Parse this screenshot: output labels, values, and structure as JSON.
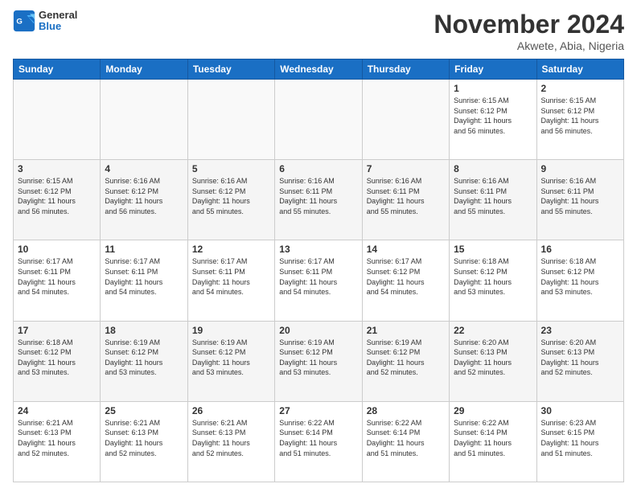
{
  "header": {
    "logo_general": "General",
    "logo_blue": "Blue",
    "month_title": "November 2024",
    "location": "Akwete, Abia, Nigeria"
  },
  "days_of_week": [
    "Sunday",
    "Monday",
    "Tuesday",
    "Wednesday",
    "Thursday",
    "Friday",
    "Saturday"
  ],
  "weeks": [
    [
      {
        "day": "",
        "info": ""
      },
      {
        "day": "",
        "info": ""
      },
      {
        "day": "",
        "info": ""
      },
      {
        "day": "",
        "info": ""
      },
      {
        "day": "",
        "info": ""
      },
      {
        "day": "1",
        "info": "Sunrise: 6:15 AM\nSunset: 6:12 PM\nDaylight: 11 hours\nand 56 minutes."
      },
      {
        "day": "2",
        "info": "Sunrise: 6:15 AM\nSunset: 6:12 PM\nDaylight: 11 hours\nand 56 minutes."
      }
    ],
    [
      {
        "day": "3",
        "info": "Sunrise: 6:15 AM\nSunset: 6:12 PM\nDaylight: 11 hours\nand 56 minutes."
      },
      {
        "day": "4",
        "info": "Sunrise: 6:16 AM\nSunset: 6:12 PM\nDaylight: 11 hours\nand 56 minutes."
      },
      {
        "day": "5",
        "info": "Sunrise: 6:16 AM\nSunset: 6:12 PM\nDaylight: 11 hours\nand 55 minutes."
      },
      {
        "day": "6",
        "info": "Sunrise: 6:16 AM\nSunset: 6:11 PM\nDaylight: 11 hours\nand 55 minutes."
      },
      {
        "day": "7",
        "info": "Sunrise: 6:16 AM\nSunset: 6:11 PM\nDaylight: 11 hours\nand 55 minutes."
      },
      {
        "day": "8",
        "info": "Sunrise: 6:16 AM\nSunset: 6:11 PM\nDaylight: 11 hours\nand 55 minutes."
      },
      {
        "day": "9",
        "info": "Sunrise: 6:16 AM\nSunset: 6:11 PM\nDaylight: 11 hours\nand 55 minutes."
      }
    ],
    [
      {
        "day": "10",
        "info": "Sunrise: 6:17 AM\nSunset: 6:11 PM\nDaylight: 11 hours\nand 54 minutes."
      },
      {
        "day": "11",
        "info": "Sunrise: 6:17 AM\nSunset: 6:11 PM\nDaylight: 11 hours\nand 54 minutes."
      },
      {
        "day": "12",
        "info": "Sunrise: 6:17 AM\nSunset: 6:11 PM\nDaylight: 11 hours\nand 54 minutes."
      },
      {
        "day": "13",
        "info": "Sunrise: 6:17 AM\nSunset: 6:11 PM\nDaylight: 11 hours\nand 54 minutes."
      },
      {
        "day": "14",
        "info": "Sunrise: 6:17 AM\nSunset: 6:12 PM\nDaylight: 11 hours\nand 54 minutes."
      },
      {
        "day": "15",
        "info": "Sunrise: 6:18 AM\nSunset: 6:12 PM\nDaylight: 11 hours\nand 53 minutes."
      },
      {
        "day": "16",
        "info": "Sunrise: 6:18 AM\nSunset: 6:12 PM\nDaylight: 11 hours\nand 53 minutes."
      }
    ],
    [
      {
        "day": "17",
        "info": "Sunrise: 6:18 AM\nSunset: 6:12 PM\nDaylight: 11 hours\nand 53 minutes."
      },
      {
        "day": "18",
        "info": "Sunrise: 6:19 AM\nSunset: 6:12 PM\nDaylight: 11 hours\nand 53 minutes."
      },
      {
        "day": "19",
        "info": "Sunrise: 6:19 AM\nSunset: 6:12 PM\nDaylight: 11 hours\nand 53 minutes."
      },
      {
        "day": "20",
        "info": "Sunrise: 6:19 AM\nSunset: 6:12 PM\nDaylight: 11 hours\nand 53 minutes."
      },
      {
        "day": "21",
        "info": "Sunrise: 6:19 AM\nSunset: 6:12 PM\nDaylight: 11 hours\nand 52 minutes."
      },
      {
        "day": "22",
        "info": "Sunrise: 6:20 AM\nSunset: 6:13 PM\nDaylight: 11 hours\nand 52 minutes."
      },
      {
        "day": "23",
        "info": "Sunrise: 6:20 AM\nSunset: 6:13 PM\nDaylight: 11 hours\nand 52 minutes."
      }
    ],
    [
      {
        "day": "24",
        "info": "Sunrise: 6:21 AM\nSunset: 6:13 PM\nDaylight: 11 hours\nand 52 minutes."
      },
      {
        "day": "25",
        "info": "Sunrise: 6:21 AM\nSunset: 6:13 PM\nDaylight: 11 hours\nand 52 minutes."
      },
      {
        "day": "26",
        "info": "Sunrise: 6:21 AM\nSunset: 6:13 PM\nDaylight: 11 hours\nand 52 minutes."
      },
      {
        "day": "27",
        "info": "Sunrise: 6:22 AM\nSunset: 6:14 PM\nDaylight: 11 hours\nand 51 minutes."
      },
      {
        "day": "28",
        "info": "Sunrise: 6:22 AM\nSunset: 6:14 PM\nDaylight: 11 hours\nand 51 minutes."
      },
      {
        "day": "29",
        "info": "Sunrise: 6:22 AM\nSunset: 6:14 PM\nDaylight: 11 hours\nand 51 minutes."
      },
      {
        "day": "30",
        "info": "Sunrise: 6:23 AM\nSunset: 6:15 PM\nDaylight: 11 hours\nand 51 minutes."
      }
    ]
  ]
}
